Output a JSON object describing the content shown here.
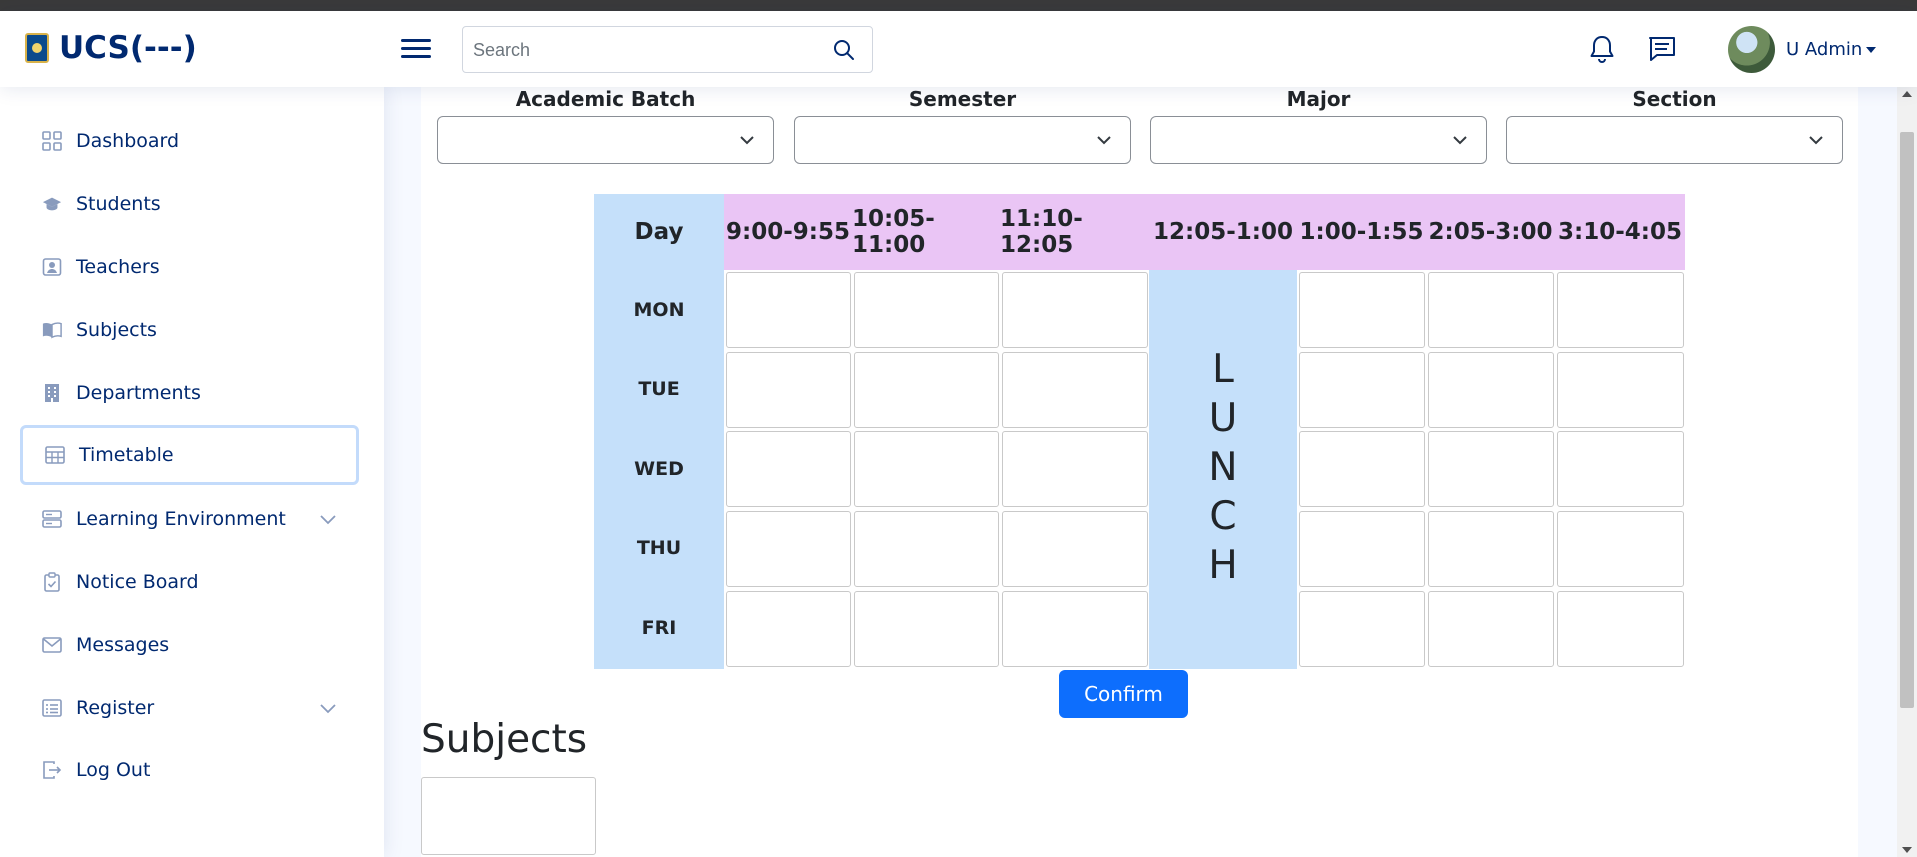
{
  "header": {
    "brand": "UCS(---)",
    "search_placeholder": "Search",
    "user_name": "U Admin"
  },
  "icons": {
    "menu": "hamburger-icon",
    "search": "search-icon",
    "notifications": "bell-icon",
    "messages": "chat-icon"
  },
  "sidebar": {
    "items": [
      {
        "label": "Dashboard"
      },
      {
        "label": "Students"
      },
      {
        "label": "Teachers"
      },
      {
        "label": "Subjects"
      },
      {
        "label": "Departments"
      },
      {
        "label": "Timetable"
      },
      {
        "label": "Learning Environment"
      },
      {
        "label": "Notice Board"
      },
      {
        "label": "Messages"
      },
      {
        "label": "Register"
      },
      {
        "label": "Log Out"
      }
    ],
    "active": "Timetable"
  },
  "filters": {
    "academic_batch": {
      "label": "Academic Batch",
      "value": ""
    },
    "semester": {
      "label": "Semester",
      "value": ""
    },
    "major": {
      "label": "Major",
      "value": ""
    },
    "section": {
      "label": "Section",
      "value": ""
    }
  },
  "timetable": {
    "day_header": "Day",
    "periods": [
      "9:00-9:55",
      "10:05-11:00",
      "11:10-12:05",
      "12:05-1:00",
      "1:00-1:55",
      "2:05-3:00",
      "3:10-4:05"
    ],
    "days": [
      "MON",
      "TUE",
      "WED",
      "THU",
      "FRI"
    ],
    "lunch_letters": [
      "L",
      "U",
      "N",
      "C",
      "H"
    ]
  },
  "confirm_label": "Confirm",
  "subjects_heading": "Subjects",
  "colors": {
    "brand": "#012970",
    "period_header": "#eac5f5",
    "day_column": "#c5e0fa",
    "primary_button": "#0d6efd"
  }
}
